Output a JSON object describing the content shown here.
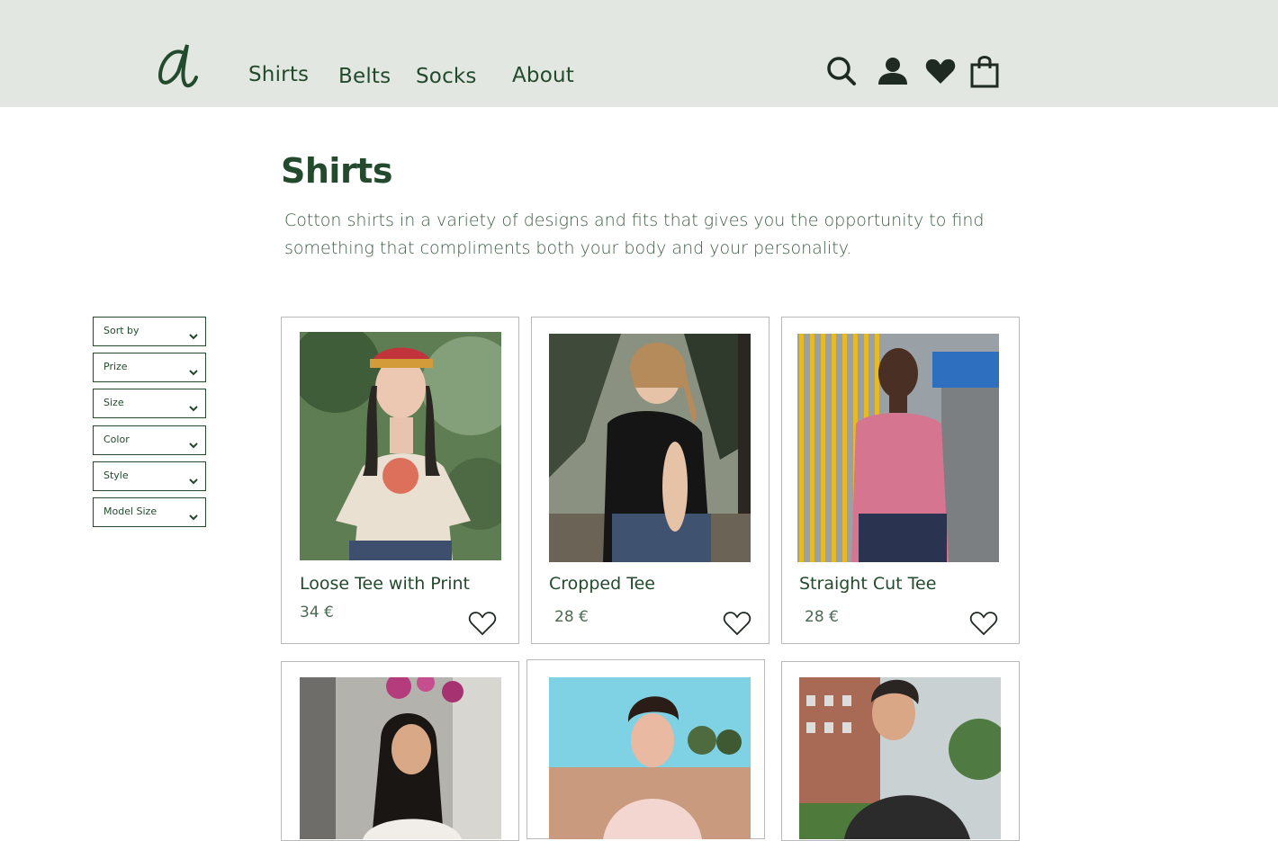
{
  "header": {
    "logo_icon": "script-a-logo",
    "nav": [
      "Shirts",
      "Belts",
      "Socks",
      "About"
    ],
    "icons": [
      "search-icon",
      "user-icon",
      "heart-icon",
      "shopping-bag-icon"
    ]
  },
  "page": {
    "title": "Shirts",
    "description": "Cotton shirts in a variety of designs and fits that gives you the opportunity to find something that compliments both your body and your personality."
  },
  "filters": [
    "Sort by",
    "Prize",
    "Size",
    "Color",
    "Style",
    "Model Size"
  ],
  "products": [
    {
      "name": "Loose Tee with Print",
      "price": "34 €"
    },
    {
      "name": "Cropped Tee",
      "price": "28 €"
    },
    {
      "name": "Straight Cut Tee",
      "price": "28 €"
    },
    {
      "name": "",
      "price": ""
    },
    {
      "name": "",
      "price": ""
    },
    {
      "name": "",
      "price": ""
    }
  ],
  "colors": {
    "header_bg": "#e2e8e1",
    "brand_green": "#234a2c",
    "card_border": "#b9b9b9"
  }
}
